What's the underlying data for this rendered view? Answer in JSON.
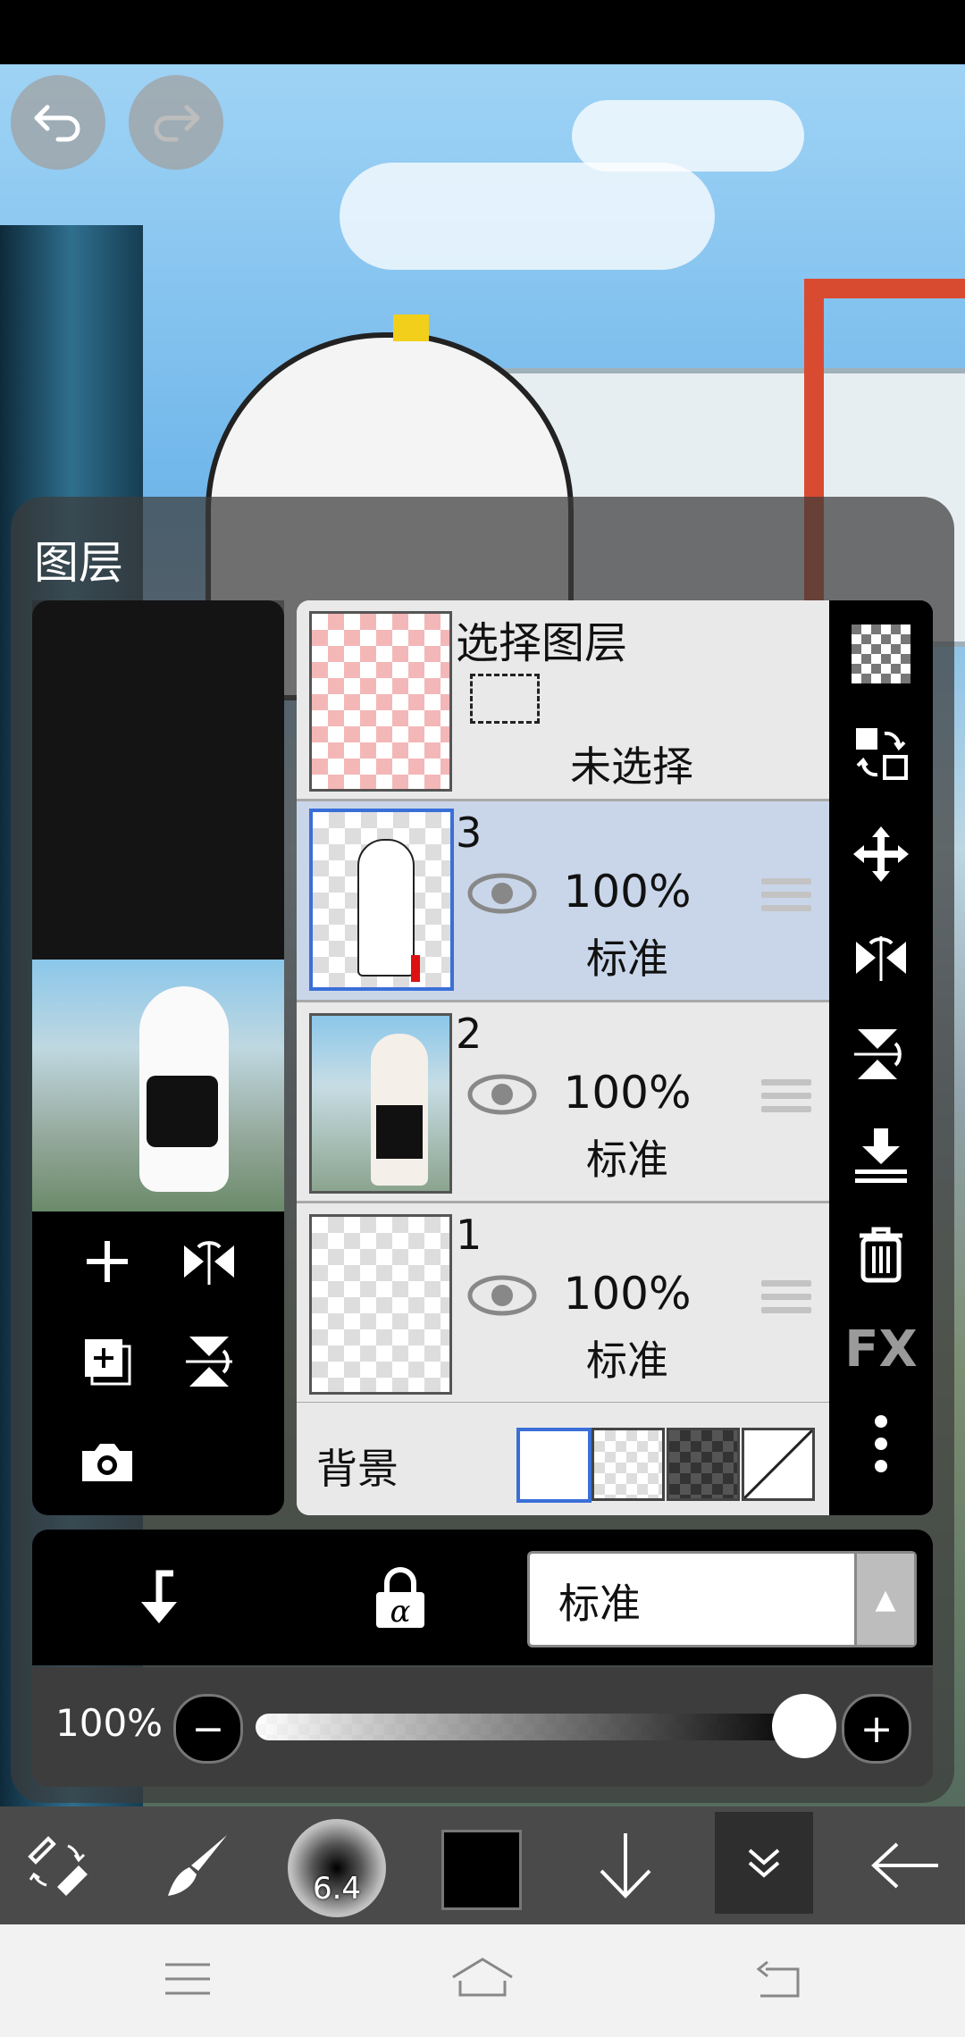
{
  "panel": {
    "title": "图层"
  },
  "selection_layer": {
    "title": "选择图层",
    "status": "未选择"
  },
  "layers": [
    {
      "number": "3",
      "opacity": "100%",
      "mode": "标准",
      "selected": true
    },
    {
      "number": "2",
      "opacity": "100%",
      "mode": "标准",
      "selected": false
    },
    {
      "number": "1",
      "opacity": "100%",
      "mode": "标准",
      "selected": false
    }
  ],
  "background": {
    "label": "背景"
  },
  "right_bar": {
    "fx_label": "FX"
  },
  "blend": {
    "mode": "标准"
  },
  "opacity": {
    "value": "100%",
    "level": 1.0
  },
  "brush": {
    "size": "6.4"
  },
  "colors": {
    "current": "#000000",
    "selected_row": "#c9d6ea",
    "accent_border": "#3a6fd8"
  }
}
